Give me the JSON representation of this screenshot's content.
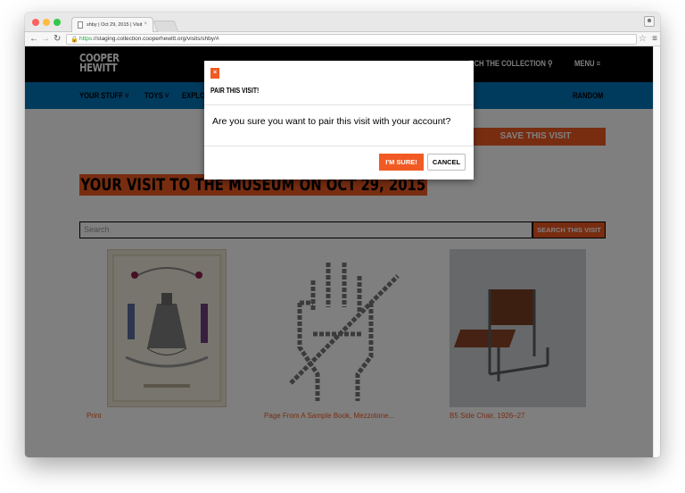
{
  "browser": {
    "tab_title": "shby | Oct 29, 2015 | Visit",
    "tab_close": "×",
    "url_https": "https",
    "url_rest": "://staging.collection.cooperhewitt.org/visits/shby/#",
    "icons": [
      "back-icon",
      "forward-icon",
      "reload-icon",
      "lock-icon",
      "star-icon",
      "menu-icon",
      "profile-icon"
    ]
  },
  "header": {
    "logo_line1": "COOPER",
    "logo_line2": "HEWITT",
    "search_collection": "RCH THE COLLECTION",
    "menu": "MENU"
  },
  "subnav": {
    "your_stuff": "YOUR STUFF",
    "toys": "TOYS",
    "explore": "EXPLO",
    "random": "RANDOM"
  },
  "page": {
    "save_visit": "SAVE THIS VISIT",
    "title": "YOUR VISIT TO THE MUSEUM ON OCT 29, 2015",
    "search_placeholder": "Search",
    "search_button": "SEARCH THIS VISIT",
    "items": [
      {
        "caption": "Print"
      },
      {
        "caption": "Page From A Sample Book, Mezzotone..."
      },
      {
        "caption": "B5 Side Chair, 1926–27"
      }
    ]
  },
  "modal": {
    "close": "×",
    "title": "PAIR THIS VISIT!",
    "message": "Are you sure you want to pair this visit with your account?",
    "confirm": "I'M SURE!",
    "cancel": "CANCEL"
  },
  "colors": {
    "accent_orange": "#f15a22",
    "nav_blue": "#0076bd",
    "header_black": "#000000"
  }
}
